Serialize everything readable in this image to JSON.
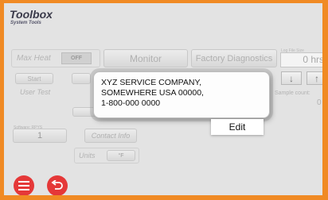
{
  "header": {
    "title": "Toolbox",
    "subtitle": "System Tools"
  },
  "max_heat": {
    "label": "Max Heat",
    "toggle": "OFF"
  },
  "monitor_label": "Monitor",
  "factory_label": "Factory Diagnostics",
  "log_file": {
    "label": "Log File Size",
    "value": "0 hrs"
  },
  "start_label": "Start",
  "user_test_label": "User Test",
  "sample_count": {
    "label": "Sample count:",
    "value": "0"
  },
  "software": {
    "label": "Software: RPYS",
    "value": "1"
  },
  "contact_info_label": "Contact Info",
  "units": {
    "label": "Units",
    "value": "°F"
  },
  "arrows": {
    "down": "↓",
    "up": "↑"
  },
  "dialog": {
    "lines": [
      "XYZ SERVICE COMPANY,",
      "SOMEWHERE USA 00000,",
      "1-800-000 0000"
    ],
    "edit_label": "Edit"
  },
  "colors": {
    "frame": "#f08a24",
    "accent": "#e53838",
    "screen": "#e3e3e3"
  },
  "icons": {
    "menu": "hamburger-icon",
    "back": "back-arrow-icon"
  }
}
